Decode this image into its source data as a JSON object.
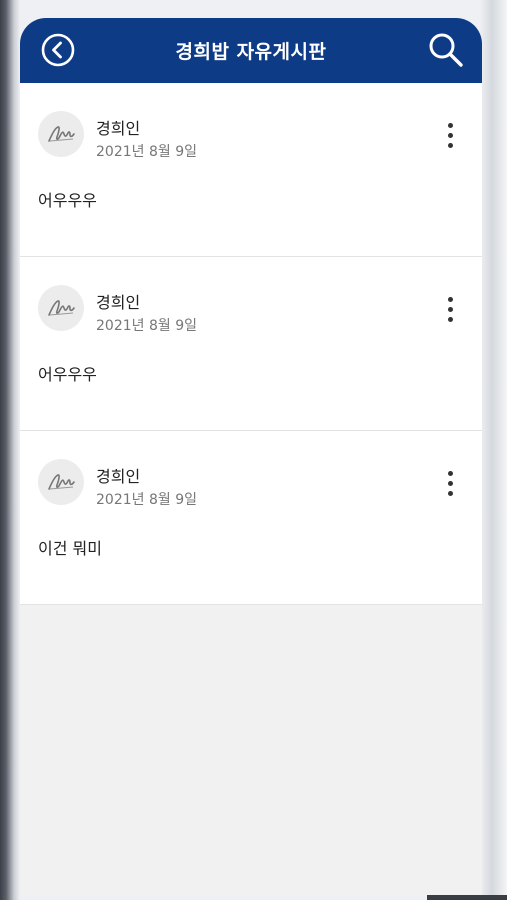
{
  "header": {
    "title": "경희밥 자유게시판",
    "back_icon": "chevron-left-circle-icon",
    "search_icon": "search-icon"
  },
  "colors": {
    "app_bar": "#0e3b86",
    "background": "#f1f1f2",
    "card": "#ffffff"
  },
  "posts": [
    {
      "author": "경희인",
      "date": "2021년 8월 9일",
      "content": "어우우우"
    },
    {
      "author": "경희인",
      "date": "2021년 8월 9일",
      "content": "어우우우"
    },
    {
      "author": "경희인",
      "date": "2021년 8월 9일",
      "content": "이건 뭐미"
    }
  ]
}
